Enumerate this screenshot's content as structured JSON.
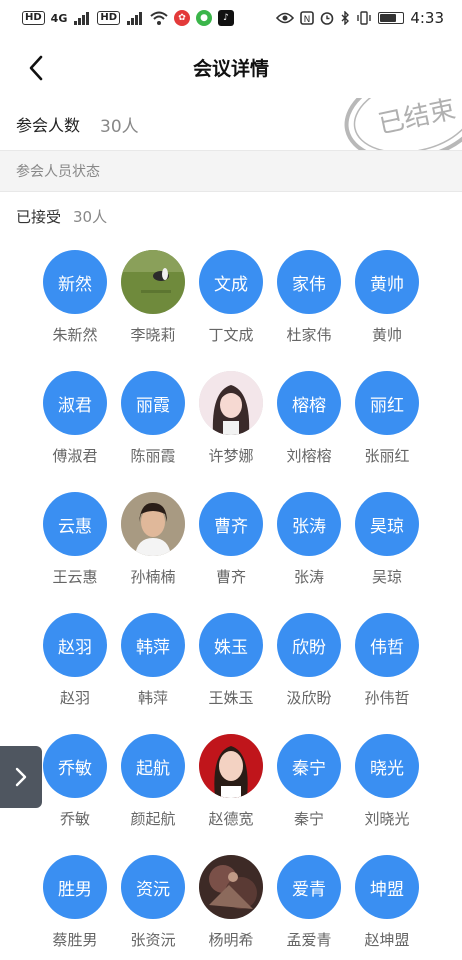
{
  "status_bar": {
    "left_items": [
      "HD",
      "4G",
      "HD"
    ],
    "time": "4:33",
    "icons": [
      "signal-icon",
      "wifi-icon",
      "eye-icon",
      "nfc-icon",
      "alarm-icon",
      "bluetooth-icon",
      "vibrate-icon",
      "battery-icon"
    ],
    "battery_level": 0.75
  },
  "header": {
    "title": "会议详情",
    "back_icon": "chevron-left-icon"
  },
  "attendance": {
    "label": "参会人数",
    "value": "30人",
    "stamp_text": "已结束"
  },
  "section": {
    "title": "参会人员状态"
  },
  "accepted": {
    "label": "已接受",
    "value": "30人"
  },
  "members": [
    {
      "avatar": "新然",
      "name": "朱新然"
    },
    {
      "avatar": "",
      "name": "李晓莉",
      "photo": "grass-photo"
    },
    {
      "avatar": "文成",
      "name": "丁文成"
    },
    {
      "avatar": "家伟",
      "name": "杜家伟"
    },
    {
      "avatar": "黄帅",
      "name": "黄帅"
    },
    {
      "avatar": "淑君",
      "name": "傅淑君"
    },
    {
      "avatar": "丽霞",
      "name": "陈丽霞"
    },
    {
      "avatar": "",
      "name": "许梦娜",
      "photo": "girl-photo"
    },
    {
      "avatar": "榕榕",
      "name": "刘榕榕"
    },
    {
      "avatar": "丽红",
      "name": "张丽红"
    },
    {
      "avatar": "云惠",
      "name": "王云惠"
    },
    {
      "avatar": "",
      "name": "孙楠楠",
      "photo": "portrait-photo"
    },
    {
      "avatar": "曹齐",
      "name": "曹齐"
    },
    {
      "avatar": "张涛",
      "name": "张涛"
    },
    {
      "avatar": "昊琼",
      "name": "吴琼"
    },
    {
      "avatar": "赵羽",
      "name": "赵羽"
    },
    {
      "avatar": "韩萍",
      "name": "韩萍"
    },
    {
      "avatar": "姝玉",
      "name": "王姝玉"
    },
    {
      "avatar": "欣盼",
      "name": "汲欣盼"
    },
    {
      "avatar": "伟哲",
      "name": "孙伟哲"
    },
    {
      "avatar": "乔敏",
      "name": "乔敏"
    },
    {
      "avatar": "起航",
      "name": "颜起航"
    },
    {
      "avatar": "",
      "name": "赵德宽",
      "photo": "woman-red-photo"
    },
    {
      "avatar": "秦宁",
      "name": "秦宁"
    },
    {
      "avatar": "晓光",
      "name": "刘晓光"
    },
    {
      "avatar": "胜男",
      "name": "蔡胜男"
    },
    {
      "avatar": "资沅",
      "name": "张资沅"
    },
    {
      "avatar": "",
      "name": "杨明希",
      "photo": "dark-art-photo"
    },
    {
      "avatar": "爱青",
      "name": "孟爱青"
    },
    {
      "avatar": "坤盟",
      "name": "赵坤盟"
    }
  ],
  "side_tab": {
    "icon": "chevron-right-icon"
  },
  "colors": {
    "avatar_blue": "#3a8ff2",
    "section_bg": "#f4f4f4",
    "side_tab_bg": "#4f5660"
  }
}
